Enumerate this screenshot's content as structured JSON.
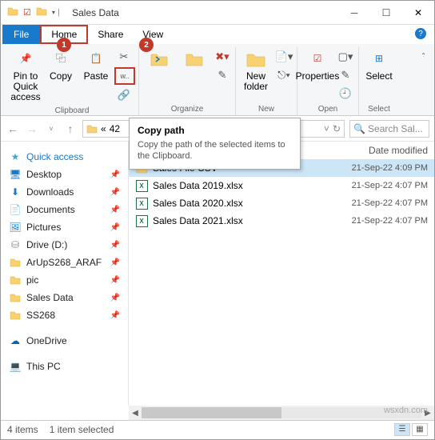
{
  "title": "Sales Data",
  "tabs": {
    "file": "File",
    "home": "Home",
    "share": "Share",
    "view": "View"
  },
  "ribbon": {
    "clipboard": {
      "label": "Clipboard",
      "pin": "Pin to Quick\naccess",
      "copy": "Copy",
      "paste": "Paste"
    },
    "organize": {
      "label": "Organize"
    },
    "new": {
      "label": "New",
      "newfolder": "New\nfolder"
    },
    "open": {
      "label": "Open",
      "props": "Properties"
    },
    "select": {
      "label": "Select",
      "btn": "Select"
    }
  },
  "tooltip": {
    "title": "Copy path",
    "body": "Copy the path of the selected items to the Clipboard."
  },
  "path": "42",
  "search_ph": "Search Sal...",
  "header_date": "Date modified",
  "tree": [
    {
      "icon": "star",
      "label": "Quick access",
      "color": "#3ba9e0"
    },
    {
      "icon": "desk",
      "label": "Desktop",
      "pin": true,
      "color": "#1979ca"
    },
    {
      "icon": "dl",
      "label": "Downloads",
      "pin": true,
      "color": "#1979ca"
    },
    {
      "icon": "doc",
      "label": "Documents",
      "pin": true,
      "color": "#555"
    },
    {
      "icon": "pic",
      "label": "Pictures",
      "pin": true,
      "color": "#1979ca"
    },
    {
      "icon": "drv",
      "label": "Drive (D:)",
      "pin": true,
      "color": "#888"
    },
    {
      "icon": "fold",
      "label": "ArUpS268_ARAF",
      "pin": true
    },
    {
      "icon": "fold",
      "label": "pic",
      "pin": true
    },
    {
      "icon": "fold",
      "label": "Sales Data",
      "pin": true
    },
    {
      "icon": "fold",
      "label": "SS268",
      "pin": true
    },
    {
      "icon": "od",
      "label": "OneDrive",
      "color": "#0a64a4"
    },
    {
      "icon": "pc",
      "label": "This PC",
      "color": "#1979ca"
    }
  ],
  "files": [
    {
      "kind": "folder",
      "name": "Sales File CSV",
      "date": "21-Sep-22 4:09 PM",
      "sel": true
    },
    {
      "kind": "xlsx",
      "name": "Sales Data 2019.xlsx",
      "date": "21-Sep-22 4:07 PM"
    },
    {
      "kind": "xlsx",
      "name": "Sales Data 2020.xlsx",
      "date": "21-Sep-22 4:07 PM"
    },
    {
      "kind": "xlsx",
      "name": "Sales Data 2021.xlsx",
      "date": "21-Sep-22 4:07 PM"
    }
  ],
  "status": {
    "items": "4 items",
    "sel": "1 item selected"
  },
  "watermark": "wsxdn.com"
}
